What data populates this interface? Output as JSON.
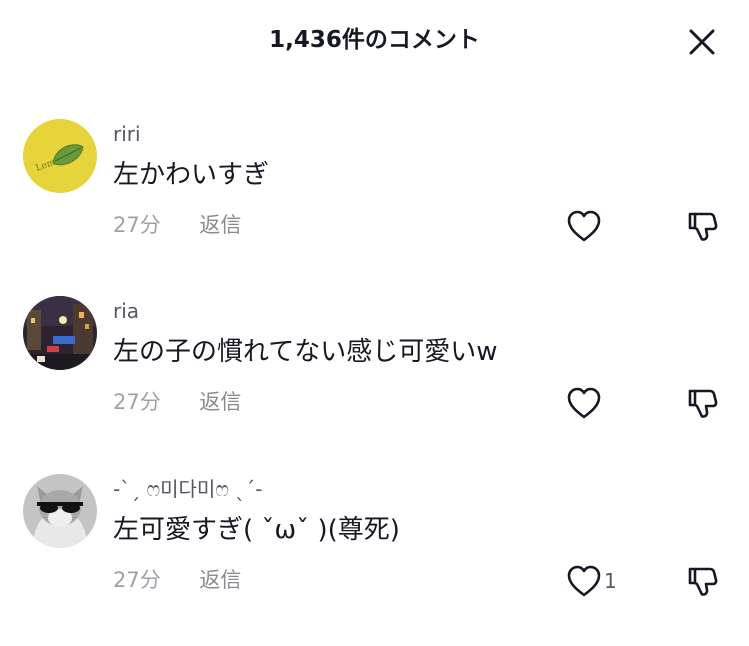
{
  "header": {
    "title": "1,436件のコメント",
    "close_icon": "close-icon"
  },
  "comments": [
    {
      "username": "riri",
      "text": "左かわいすぎ",
      "time": "27分",
      "reply_label": "返信",
      "like_count": "",
      "avatar": {
        "kind": "lemon-logo",
        "color": "#e8d437",
        "logo_text": "Lemon"
      }
    },
    {
      "username": "ria",
      "text": "左の子の慣れてない感じ可愛いw",
      "time": "27分",
      "reply_label": "返信",
      "like_count": "",
      "avatar": {
        "kind": "city-night-photo",
        "color": "#3b2a3a"
      }
    },
    {
      "username": "-ˋˏ ෆ미다미ෆ ˎˊ-",
      "text": "左可愛すぎ( ˇωˇ )(尊死)",
      "time": "27分",
      "reply_label": "返信",
      "like_count": "1",
      "avatar": {
        "kind": "cat-with-sunglasses-photo",
        "color": "#bdbdbd"
      }
    }
  ],
  "icons": {
    "like": "heart-outline-icon",
    "dislike": "thumbs-down-outline-icon"
  },
  "colors": {
    "text_primary": "#161823",
    "text_secondary": "#555761",
    "text_meta": "#a0a1a8",
    "icon_stroke": "#161823"
  }
}
